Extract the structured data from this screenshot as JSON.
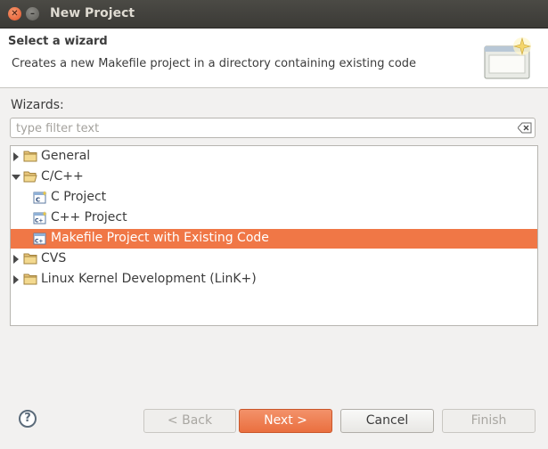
{
  "window": {
    "title": "New Project"
  },
  "banner": {
    "title": "Select a wizard",
    "description": "Creates a new Makefile project in a directory containing existing code",
    "icon": "new-wizard-icon"
  },
  "wizards": {
    "label": "Wizards:",
    "filter_placeholder": "type filter text",
    "filter_value": ""
  },
  "tree": {
    "items": [
      {
        "label": "General",
        "expanded": false,
        "icon": "folder-icon"
      },
      {
        "label": "C/C++",
        "expanded": true,
        "icon": "folder-icon"
      },
      {
        "label": "C Project",
        "icon": "c-project-icon"
      },
      {
        "label": "C++ Project",
        "icon": "cpp-project-icon"
      },
      {
        "label": "Makefile Project with Existing Code",
        "icon": "makefile-project-icon",
        "selected": true
      },
      {
        "label": "CVS",
        "expanded": false,
        "icon": "folder-icon"
      },
      {
        "label": "Linux Kernel Development (LinK+)",
        "expanded": false,
        "icon": "folder-icon"
      }
    ]
  },
  "buttons": {
    "help": "?",
    "back": "< Back",
    "next": "Next >",
    "cancel": "Cancel",
    "finish": "Finish"
  },
  "colors": {
    "selection": "#f07746",
    "accent": "#ea6f3f"
  }
}
